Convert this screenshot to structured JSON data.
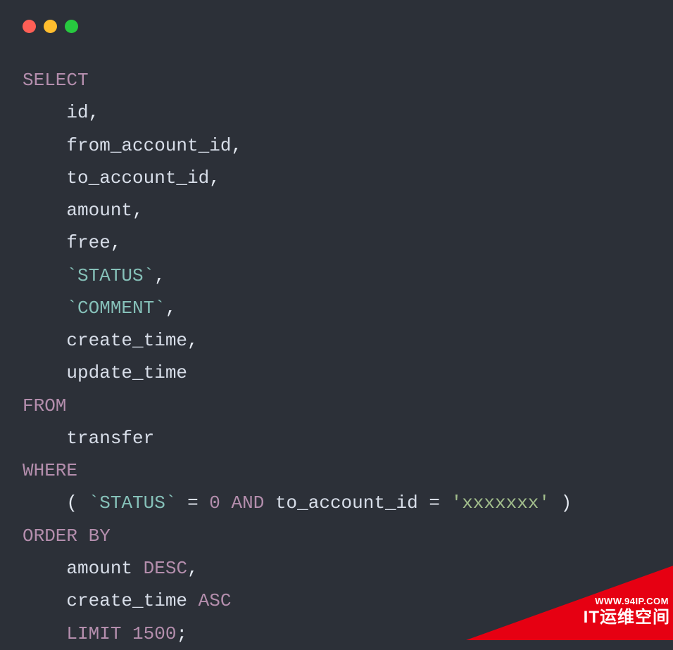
{
  "code": {
    "tokens": [
      [
        {
          "t": "SELECT",
          "c": "kw"
        }
      ],
      [
        {
          "t": "    id",
          "c": "id"
        },
        {
          "t": ",",
          "c": "pn"
        }
      ],
      [
        {
          "t": "    from_account_id",
          "c": "id"
        },
        {
          "t": ",",
          "c": "pn"
        }
      ],
      [
        {
          "t": "    to_account_id",
          "c": "id"
        },
        {
          "t": ",",
          "c": "pn"
        }
      ],
      [
        {
          "t": "    amount",
          "c": "id"
        },
        {
          "t": ",",
          "c": "pn"
        }
      ],
      [
        {
          "t": "    free",
          "c": "id"
        },
        {
          "t": ",",
          "c": "pn"
        }
      ],
      [
        {
          "t": "    ",
          "c": "id"
        },
        {
          "t": "`STATUS`",
          "c": "bt"
        },
        {
          "t": ",",
          "c": "pn"
        }
      ],
      [
        {
          "t": "    ",
          "c": "id"
        },
        {
          "t": "`COMMENT`",
          "c": "bt"
        },
        {
          "t": ",",
          "c": "pn"
        }
      ],
      [
        {
          "t": "    create_time",
          "c": "id"
        },
        {
          "t": ",",
          "c": "pn"
        }
      ],
      [
        {
          "t": "    update_time",
          "c": "id"
        }
      ],
      [
        {
          "t": "FROM",
          "c": "kw"
        }
      ],
      [
        {
          "t": "    transfer",
          "c": "id"
        }
      ],
      [
        {
          "t": "WHERE",
          "c": "kw"
        }
      ],
      [
        {
          "t": "    ",
          "c": "id"
        },
        {
          "t": "(",
          "c": "pn"
        },
        {
          "t": " ",
          "c": "id"
        },
        {
          "t": "`STATUS`",
          "c": "bt"
        },
        {
          "t": " ",
          "c": "id"
        },
        {
          "t": "=",
          "c": "pn"
        },
        {
          "t": " ",
          "c": "id"
        },
        {
          "t": "0",
          "c": "num"
        },
        {
          "t": " ",
          "c": "id"
        },
        {
          "t": "AND",
          "c": "kw"
        },
        {
          "t": " to_account_id ",
          "c": "id"
        },
        {
          "t": "=",
          "c": "pn"
        },
        {
          "t": " ",
          "c": "id"
        },
        {
          "t": "'xxxxxxx'",
          "c": "str"
        },
        {
          "t": " ",
          "c": "id"
        },
        {
          "t": ")",
          "c": "pn"
        }
      ],
      [
        {
          "t": "ORDER BY",
          "c": "kw"
        }
      ],
      [
        {
          "t": "    amount ",
          "c": "id"
        },
        {
          "t": "DESC",
          "c": "kw"
        },
        {
          "t": ",",
          "c": "pn"
        }
      ],
      [
        {
          "t": "    create_time ",
          "c": "id"
        },
        {
          "t": "ASC",
          "c": "kw"
        }
      ],
      [
        {
          "t": "    ",
          "c": "id"
        },
        {
          "t": "LIMIT",
          "c": "kw"
        },
        {
          "t": " ",
          "c": "id"
        },
        {
          "t": "1500",
          "c": "num"
        },
        {
          "t": ";",
          "c": "pn"
        }
      ]
    ]
  },
  "banner": {
    "url": "WWW.94IP.COM",
    "text": "IT运维空间"
  }
}
